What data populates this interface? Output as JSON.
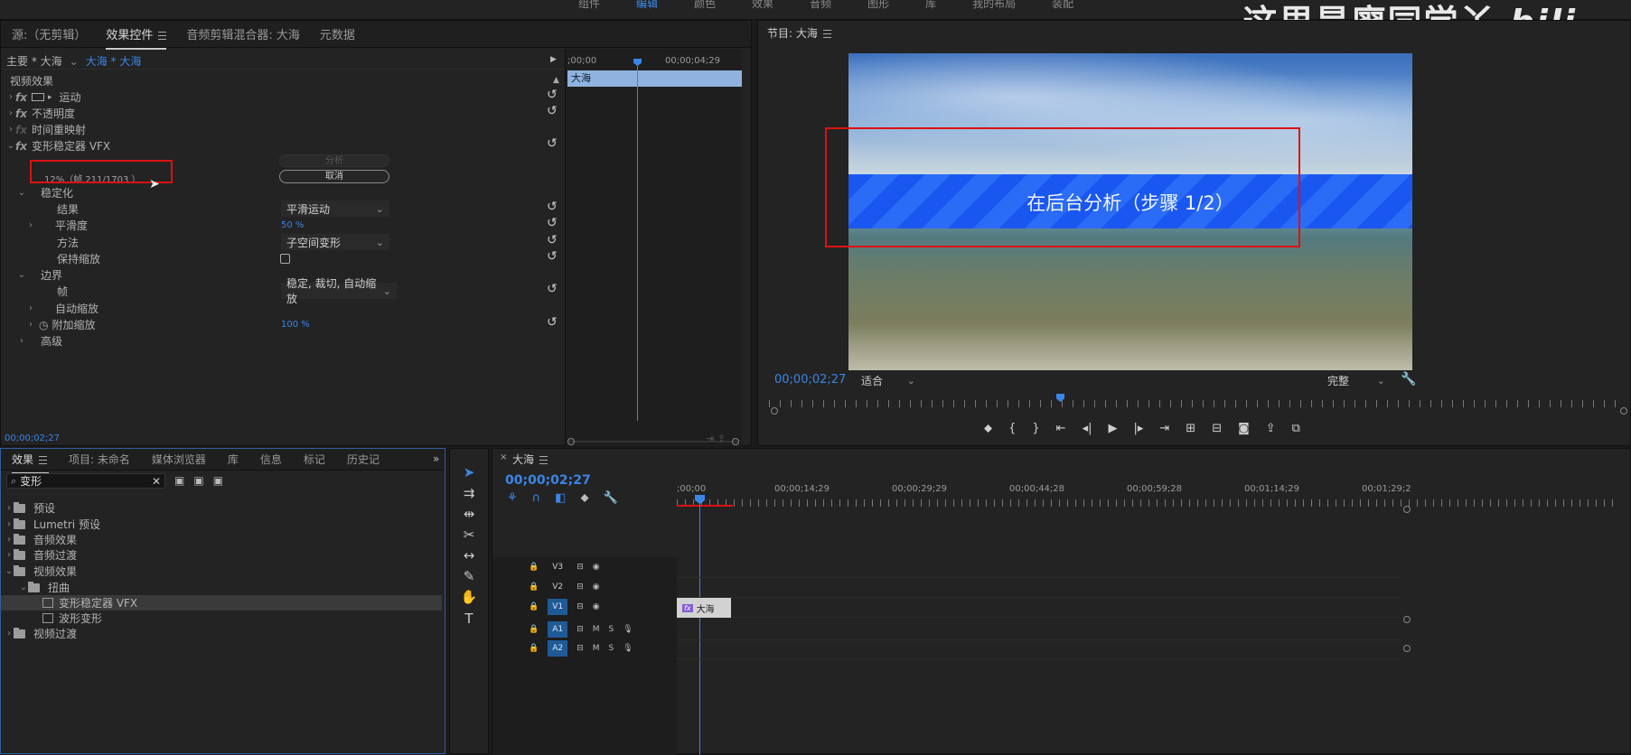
{
  "workspace": {
    "items": [
      "组件",
      "编辑",
      "颜色",
      "效果",
      "音频",
      "图形",
      "库",
      "我的布局",
      "装配"
    ],
    "active_index": 1
  },
  "watermark": "这里是廖同学丫",
  "watermark_logo": "bili",
  "top_panel": {
    "tabs": [
      "源:（无剪辑）",
      "效果控件",
      "音频剪辑混合器: 大海",
      "元数据"
    ],
    "active_tab": 1,
    "clip_master": "主要 * 大海",
    "clip_seq": "大海 * 大海",
    "mini_ruler": {
      "start": ";00;00",
      "end": "00;00;04;29"
    },
    "clip_bar_label": "大海",
    "section": "视频效果",
    "effects": [
      {
        "name": "运动",
        "expanded": false
      },
      {
        "name": "不透明度",
        "expanded": false
      },
      {
        "name": "时间重映射",
        "expanded": false
      },
      {
        "name": "变形稳定器 VFX",
        "expanded": true
      }
    ],
    "analyze_button": "分析",
    "progress_text": "12%（帧 211/1703 ）",
    "progress_fraction": 0.12,
    "cancel_button": "取消",
    "stabilization_label": "稳定化",
    "result_label": "结果",
    "result_value": "平滑运动",
    "smoothness_label": "平滑度",
    "smoothness_value": "50 %",
    "method_label": "方法",
    "method_value": "子空间变形",
    "keep_scale_label": "保持缩放",
    "border_label": "边界",
    "frame_label": "帧",
    "frame_value": "稳定, 裁切, 自动缩放",
    "auto_scale_label": "自动缩放",
    "additional_scale_label": "附加缩放",
    "additional_scale_value": "100 %",
    "advanced_label": "高级",
    "timecode": "00;00;02;27"
  },
  "program": {
    "title": "节目: 大海",
    "overlay_text": "在后台分析（步骤 1/2）",
    "timecode": "00;00;02;27",
    "fit": "适合",
    "quality": "完整"
  },
  "effects_panel": {
    "tabs": [
      "效果",
      "项目: 未命名",
      "媒体浏览器",
      "库",
      "信息",
      "标记",
      "历史记"
    ],
    "search_value": "变形",
    "tree": [
      {
        "label": "预设",
        "level": 0
      },
      {
        "label": "Lumetri 预设",
        "level": 0
      },
      {
        "label": "音频效果",
        "level": 0
      },
      {
        "label": "音频过渡",
        "level": 0
      },
      {
        "label": "视频效果",
        "level": 0
      },
      {
        "label": "扭曲",
        "level": 1
      },
      {
        "label": "变形稳定器 VFX",
        "level": 2
      },
      {
        "label": "波形变形",
        "level": 2
      },
      {
        "label": "视频过渡",
        "level": 0
      }
    ]
  },
  "timeline": {
    "title": "大海",
    "timecode": "00;00;02;27",
    "ruler": [
      ";00;00",
      "00;00;14;29",
      "00;00;29;29",
      "00;00;44;28",
      "00;00;59;28",
      "00;01;14;29",
      "00;01;29;2"
    ],
    "tracks": [
      "V3",
      "V2",
      "V1",
      "A1",
      "A2"
    ],
    "clip_label": "大海",
    "track_letters": {
      "mute": "M",
      "solo": "S"
    },
    "tool_type": "T"
  }
}
